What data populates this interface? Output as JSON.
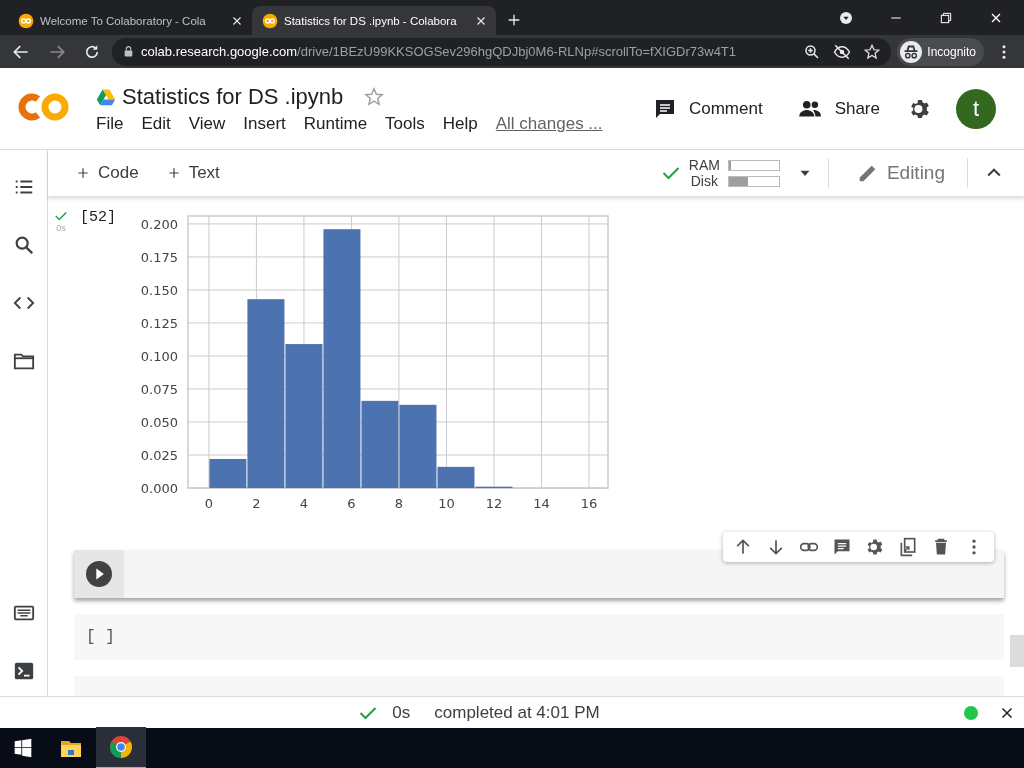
{
  "browser": {
    "tabs": [
      {
        "title": "Welcome To Colaboratory - Cola",
        "selected": false
      },
      {
        "title": "Statistics for DS .ipynb - Colabora",
        "selected": true
      }
    ],
    "address": {
      "host": "colab.research.google.com",
      "path": "/drive/1BEzU99KKSOGSev296hgQDJbj0M6-RLNp#scrollTo=fXIGDr73w4T1"
    },
    "profile": "Incognito"
  },
  "notebook": {
    "title": "Statistics for DS .ipynb",
    "menu": [
      "File",
      "Edit",
      "View",
      "Insert",
      "Runtime",
      "Tools",
      "Help"
    ],
    "save_status": "All changes ...",
    "comment": "Comment",
    "share": "Share",
    "avatar": "t"
  },
  "toolbar": {
    "add": [
      "Code",
      "Text"
    ],
    "resources": [
      {
        "label": "RAM",
        "level": 0.05
      },
      {
        "label": "Disk",
        "level": 0.38
      }
    ],
    "mode": "Editing"
  },
  "cells": [
    {
      "kind": "output",
      "done": true,
      "time": "0s",
      "count": "[52]",
      "chart_data": {
        "type": "bar",
        "x": [
          0.8,
          2.4,
          4,
          5.6,
          7.2,
          8.8,
          10.4,
          12,
          13.6,
          15.2
        ],
        "values": [
          0.022,
          0.143,
          0.109,
          0.196,
          0.066,
          0.063,
          0.016,
          0.001,
          0,
          0
        ],
        "grid": true,
        "xlim": [
          -0.88,
          16.8
        ],
        "ylim": [
          0,
          0.206
        ],
        "xticks": [
          0,
          2,
          4,
          6,
          8,
          10,
          12,
          14,
          16
        ],
        "yticks": [
          {
            "value": 0,
            "label": "0.000"
          },
          {
            "value": 0.025,
            "label": "0.025"
          },
          {
            "value": 0.05,
            "label": "0.050"
          },
          {
            "value": 0.075,
            "label": "0.075"
          },
          {
            "value": 0.1,
            "label": "0.100"
          },
          {
            "value": 0.125,
            "label": "0.125"
          },
          {
            "value": 0.15,
            "label": "0.150"
          },
          {
            "value": 0.175,
            "label": "0.175"
          },
          {
            "value": 0.2,
            "label": "0.200"
          }
        ]
      }
    },
    {
      "kind": "focused",
      "selected": true
    },
    {
      "kind": "empty",
      "count": "[ ]"
    },
    {
      "kind": "partial"
    }
  ],
  "status": {
    "time": "0s",
    "message": "completed at 4:01 PM",
    "connected": true
  }
}
